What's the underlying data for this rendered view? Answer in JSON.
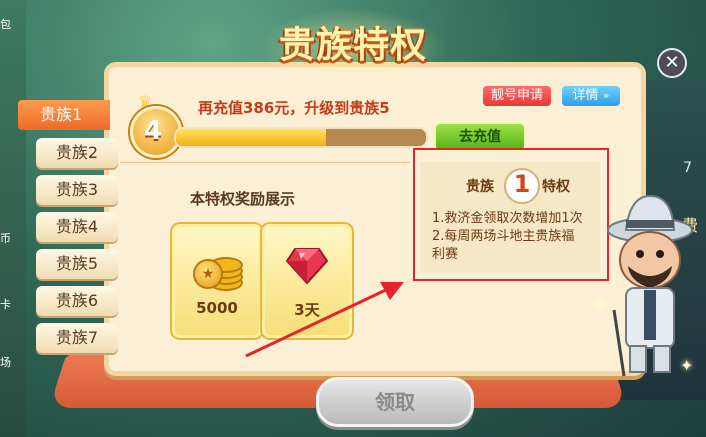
{
  "dialog": {
    "title": "贵族特权",
    "close_icon": "close-icon"
  },
  "tabs": [
    "贵族1",
    "贵族2",
    "贵族3",
    "贵族4",
    "贵族5",
    "贵族6",
    "贵族7"
  ],
  "active_tab": "贵族1",
  "current_level": {
    "badge_number": "4",
    "upgrade_text": "再充值386元，升级到贵族5",
    "progress_fraction": 0.6
  },
  "buttons": {
    "vanity_apply": "靓号申请",
    "details": "详情",
    "recharge": "去充值",
    "claim": "领取"
  },
  "rewards": {
    "heading": "本特权奖励展示",
    "items": [
      {
        "icon": "gold-coins-icon",
        "label": "5000"
      },
      {
        "icon": "gem-icon",
        "label": "3天"
      }
    ]
  },
  "privilege": {
    "prefix": "贵族",
    "level": "1",
    "suffix": "特权",
    "lines": [
      "1.救济金领取次数增加1次",
      "2.每周两场斗地主贵族福",
      "利赛"
    ]
  },
  "background": {
    "left_labels": [
      "包",
      "币",
      "卡",
      "场"
    ],
    "right_labels": [
      "费",
      "7"
    ]
  },
  "colors": {
    "accent_orange": "#ee6a2b",
    "highlight_red": "#e5232a",
    "recharge_green": "#55b21c"
  }
}
